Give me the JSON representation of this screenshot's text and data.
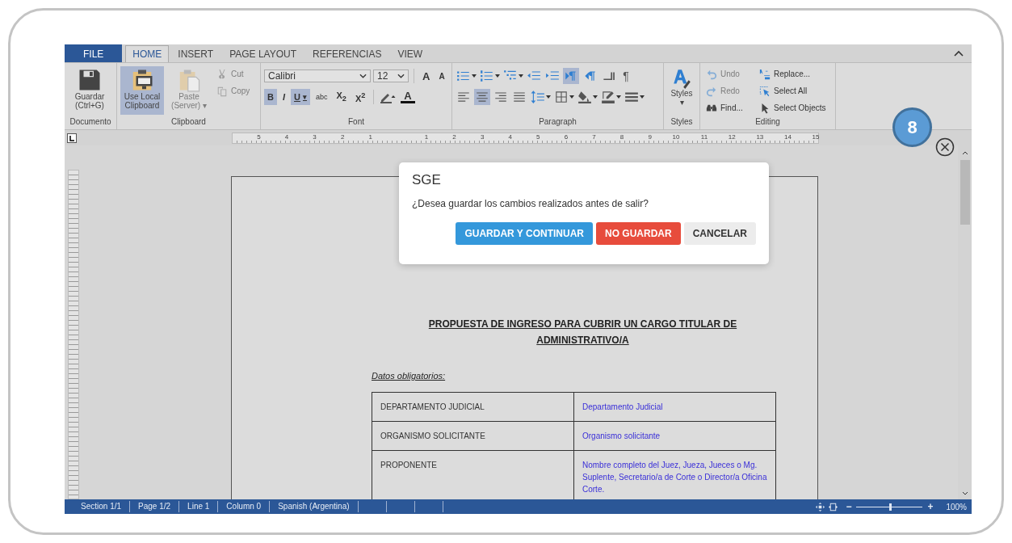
{
  "tabs": [
    {
      "label": "FILE",
      "kind": "file",
      "selected": false
    },
    {
      "label": "HOME",
      "kind": "tab",
      "selected": true
    },
    {
      "label": "INSERT",
      "kind": "tab",
      "selected": false
    },
    {
      "label": "PAGE LAYOUT",
      "kind": "tab",
      "selected": false
    },
    {
      "label": "REFERENCIAS",
      "kind": "tab",
      "selected": false
    },
    {
      "label": "VIEW",
      "kind": "tab",
      "selected": false
    }
  ],
  "ribbon": {
    "documento": {
      "label": "Documento",
      "save": {
        "label": "Guardar (Ctrl+G)"
      }
    },
    "clipboard": {
      "label": "Clipboard",
      "use_local": {
        "label": "Use Local Clipboard",
        "on": true
      },
      "paste": {
        "label": "Paste (Server) ▾",
        "disabled": true
      },
      "small": [
        {
          "label": "Cut",
          "kind": "cut",
          "disabled": true
        },
        {
          "label": "Copy",
          "kind": "copy",
          "disabled": true
        }
      ]
    },
    "font": {
      "label": "Font",
      "family": "Calibri",
      "size": "12",
      "grow": "A",
      "shrink": "A",
      "format": [
        {
          "label": "B",
          "on": true
        },
        {
          "label": "I",
          "on": false
        },
        {
          "label": "U",
          "on": true,
          "caret": "▾"
        },
        {
          "label": "abc",
          "on": false
        },
        {
          "label": "X$_{2}$",
          "on": false
        },
        {
          "label": "X$^{2}$",
          "on": false
        }
      ],
      "color_letter": "A"
    },
    "paragraph": {
      "label": "Paragraph",
      "row1": [
        {
          "kind": "bullets",
          "on": false,
          "caret": true
        },
        {
          "kind": "numbering",
          "on": false,
          "caret": true
        },
        {
          "kind": "multilevel",
          "on": false,
          "caret": true
        },
        {
          "kind": "outdent",
          "on": false,
          "caret": false
        },
        {
          "kind": "indent",
          "on": false,
          "caret": false
        },
        {
          "kind": "ltr",
          "on": true,
          "caret": false
        },
        {
          "kind": "rtl",
          "on": false,
          "caret": false
        },
        {
          "kind": "break",
          "on": false,
          "caret": false
        },
        {
          "kind": "pilcrow",
          "label": "¶",
          "on": false
        }
      ],
      "row2": [
        {
          "kind": "align-left",
          "on": false,
          "caret": false
        },
        {
          "kind": "align-center",
          "on": true,
          "caret": false
        },
        {
          "kind": "align-right",
          "on": false,
          "caret": false
        },
        {
          "kind": "justify",
          "on": false,
          "caret": false
        },
        {
          "kind": "spacing",
          "on": false,
          "caret": true
        },
        {
          "kind": "borders",
          "on": false,
          "caret": true
        },
        {
          "kind": "shading",
          "on": false,
          "caret": true
        },
        {
          "kind": "pen",
          "on": false,
          "caret": true
        },
        {
          "kind": "linestyle",
          "on": false,
          "caret": true
        }
      ]
    },
    "styles": {
      "label": "Styles",
      "button": "Styles",
      "caret": "▾"
    },
    "editing": {
      "label": "Editing",
      "items": [
        {
          "label": "Undo",
          "kind": "undo",
          "disabled": true
        },
        {
          "label": "Redo",
          "kind": "redo",
          "disabled": true
        },
        {
          "label": "Find...",
          "kind": "find",
          "disabled": false
        },
        {
          "label": "Replace...",
          "kind": "replace",
          "disabled": false
        },
        {
          "label": "Select All",
          "kind": "selectall",
          "disabled": false
        },
        {
          "label": "Select Objects",
          "kind": "cursor",
          "disabled": false
        }
      ]
    }
  },
  "ruler": {
    "left_numbers": [
      "5",
      "4",
      "3",
      "2",
      "1"
    ],
    "right_numbers": [
      "1",
      "2",
      "3",
      "4",
      "5",
      "6",
      "7",
      "8",
      "9",
      "10",
      "11",
      "12",
      "13",
      "14",
      "15"
    ]
  },
  "badge": "8",
  "dialog": {
    "title": "SGE",
    "message": "¿Desea guardar los cambios realizados antes de salir?",
    "buttons": [
      {
        "label": "GUARDAR Y CONTINUAR",
        "kind": "primary"
      },
      {
        "label": "NO GUARDAR",
        "kind": "danger"
      },
      {
        "label": "CANCELAR",
        "kind": "default"
      }
    ]
  },
  "document": {
    "title_lines": [
      "PROPUESTA DE INGRESO PARA CUBRIR UN CARGO TITULAR DE",
      "ADMINISTRATIVO/A"
    ],
    "subtitle": "Datos obligatorios:",
    "rows": [
      {
        "label": "DEPARTAMENTO JUDICIAL",
        "value": "Departamento Judicial"
      },
      {
        "label": "ORGANISMO SOLICITANTE",
        "value": "Organismo solicitante"
      },
      {
        "label": "PROPONENTE",
        "value": "Nombre completo del Juez, Jueza, Jueces o Mg. Suplente, Secretario/a de Corte o Director/a Oficina Corte."
      }
    ]
  },
  "status_bar": {
    "items": [
      "Section 1/1",
      "Page 1/2",
      "Line 1",
      "Column 0",
      "Spanish (Argentina)"
    ],
    "minus": "−",
    "plus": "+",
    "zoom": {
      "level": 0.5,
      "reading": "100%"
    }
  }
}
